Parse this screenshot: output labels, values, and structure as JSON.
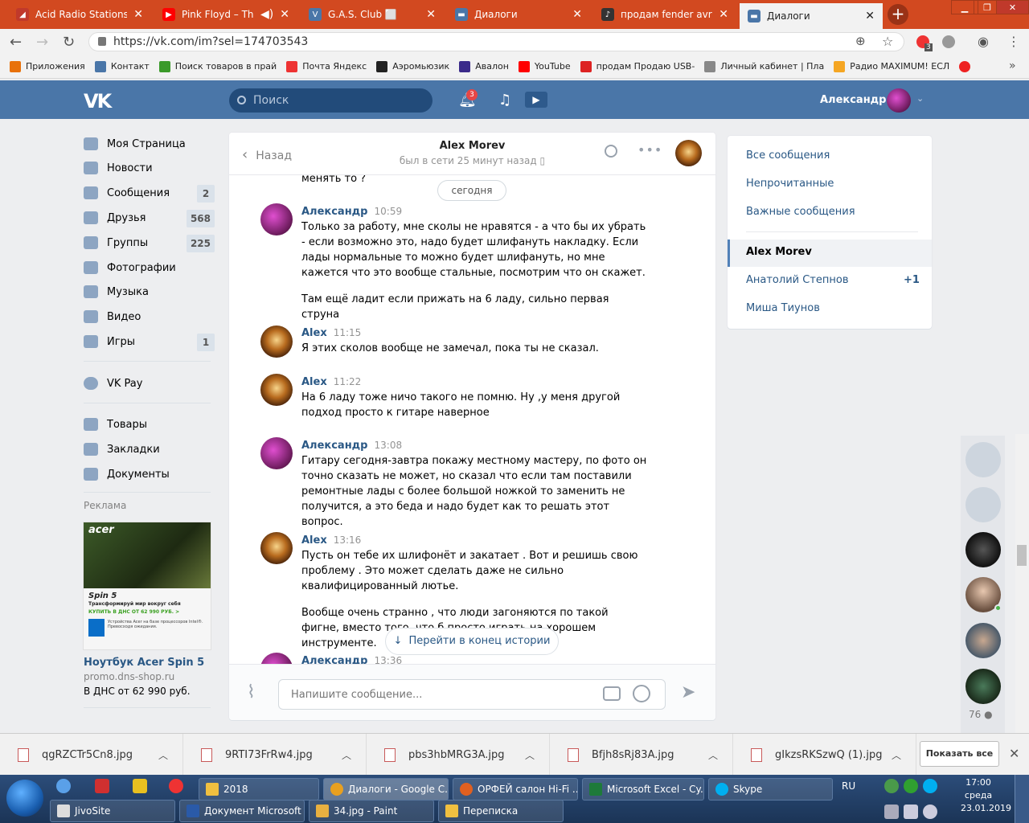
{
  "browser": {
    "tabs": [
      {
        "title": "Acid Radio Stations",
        "color": "#c0392b"
      },
      {
        "title": "Pink Floyd – The Dr",
        "color": "#ff0000"
      },
      {
        "title": "G.A.S. Club ⬜",
        "color": "#4a76a8"
      },
      {
        "title": "Диалоги",
        "color": "#4a76a8"
      },
      {
        "title": "продам fender avri62 7",
        "color": "#333333"
      },
      {
        "title": "Диалоги",
        "color": "#4a76a8"
      }
    ],
    "url": "https://vk.com/im?sel=174703543",
    "bookmarks": [
      "Приложения",
      "Контакт",
      "Поиск товаров в прай",
      "Почта Яндекс",
      "Аэромьюзик",
      "Авалон",
      "YouTube",
      "продам Продаю USB-",
      "Личный кабинет | Пла",
      "Радио MAXIMUM! ЕСЛ"
    ],
    "ext_badge": "3"
  },
  "vk": {
    "logo": "VK",
    "search_placeholder": "Поиск",
    "notif_count": "3",
    "user_name": "Александр",
    "menu": [
      {
        "label": "Моя Страница",
        "count": ""
      },
      {
        "label": "Новости",
        "count": ""
      },
      {
        "label": "Сообщения",
        "count": "2"
      },
      {
        "label": "Друзья",
        "count": "568"
      },
      {
        "label": "Группы",
        "count": "225"
      },
      {
        "label": "Фотографии",
        "count": ""
      },
      {
        "label": "Музыка",
        "count": ""
      },
      {
        "label": "Видео",
        "count": ""
      },
      {
        "label": "Игры",
        "count": "1"
      }
    ],
    "menu2": [
      "VK Pay"
    ],
    "menu3": [
      "Товары",
      "Закладки",
      "Документы"
    ],
    "ad": {
      "label": "Реклама",
      "brand": "acer",
      "model": "Spin 5",
      "tagline": "Трансформируй мир вокруг себя",
      "buy": "КУПИТЬ В ДНС ОТ 62 990 РУБ. >",
      "small": "Устройства Acer на базе процессоров Intel®. Превосходя ожидания.",
      "title": "Ноутбук Acer Spin 5",
      "domain": "promo.dns-shop.ru",
      "desc": "В ДНС от 62 990 руб."
    }
  },
  "chat": {
    "back": "Назад",
    "peer_name": "Alex Morev",
    "peer_status": "был в сети 25 минут назад",
    "prev_text": "менять то ?",
    "date": "сегодня",
    "messages": [
      {
        "author": "Александр",
        "time": "10:59",
        "text": "Только за работу, мне сколы не нравятся - а что бы их убрать - если возможно это, надо будет шлифануть накладку. Если лады нормальные то можно будет шлифануть, но мне кажется что это вообще стальные, посмотрим что он скажет.",
        "text2": "Там ещё ладит если прижать на 6 ладу, сильно первая струна"
      },
      {
        "author": "Alex",
        "time": "11:15",
        "text": "Я этих сколов вообще не замечал, пока ты не сказал.",
        "text2": ""
      },
      {
        "author": "Alex",
        "time": "11:22",
        "text": "На 6 ладу тоже ничо такого не помню. Ну ,у меня другой подход просто к гитаре наверное",
        "text2": ""
      },
      {
        "author": "Александр",
        "time": "13:08",
        "text": "Гитару сегодня-завтра покажу местному мастеру, по фото он точно сказать не может, но сказал что если там поставили ремонтные лады с более большой ножкой то заменить не получится, а это беда и надо будет как то решать этот вопрос.",
        "text2": ""
      },
      {
        "author": "Alex",
        "time": "13:16",
        "text": "Пусть он тебе их шлифонёт и закатает . Вот и решишь свою проблему . Это может сделать даже не сильно квалифицированный лютье.",
        "text2": "Вообще очень странно , что люди загоняются по такой фигне, вместо того ,что б просто играть на хорошем инструменте."
      },
      {
        "author": "Александр",
        "time": "13:36",
        "text": "",
        "text2": ""
      }
    ],
    "jump_label": "Перейти в конец истории",
    "input_placeholder": "Напишите сообщение..."
  },
  "right_panel": {
    "filters": [
      "Все сообщения",
      "Непрочитанные",
      "Важные сообщения"
    ],
    "dialogs": [
      {
        "name": "Alex Morev",
        "badge": ""
      },
      {
        "name": "Анатолий Степнов",
        "badge": "+1"
      },
      {
        "name": "Миша Тиунов",
        "badge": ""
      }
    ]
  },
  "friends_count": "76",
  "downloads": {
    "files": [
      "qgRZCTr5Cn8.jpg",
      "9RTI73FrRw4.jpg",
      "pbs3hbMRG3A.jpg",
      "Bfjh8sRj83A.jpg",
      "gIkzsRKSzwQ (1).jpg"
    ],
    "show_all": "Показать все"
  },
  "taskbar": {
    "row1": [
      "2018",
      "Диалоги - Google C...",
      "ОРФЕЙ салон Hi-Fi ...",
      "Microsoft Excel - Cy...",
      "Skype"
    ],
    "row2": [
      "JivoSite",
      "Документ Microsoft ...",
      "34.jpg - Paint",
      "Переписка"
    ],
    "lang": "RU",
    "time": "17:00",
    "weekday": "среда",
    "date": "23.01.2019"
  }
}
